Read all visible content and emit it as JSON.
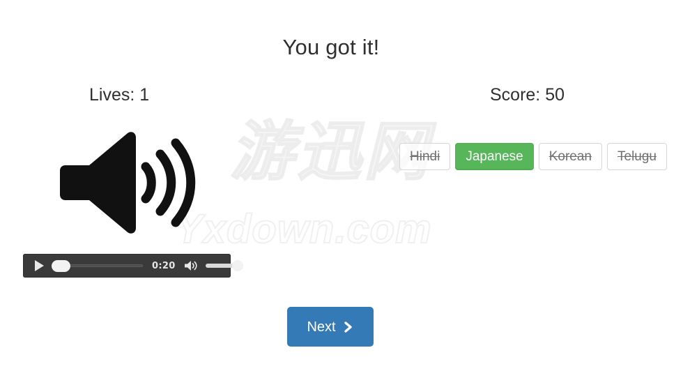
{
  "page": {
    "title": "You got it!",
    "background_color": "#ffffff"
  },
  "status": {
    "lives_label": "Lives: 1",
    "score_label": "Score: 50"
  },
  "prompt": {
    "icon": "speaker-volume-icon"
  },
  "answers": {
    "options": [
      {
        "label": "Hindi",
        "state": "eliminated"
      },
      {
        "label": "Japanese",
        "state": "correct"
      },
      {
        "label": "Korean",
        "state": "eliminated"
      },
      {
        "label": "Telugu",
        "state": "eliminated"
      }
    ],
    "correct_color": "#57b65a",
    "eliminated_text_color": "#707070"
  },
  "audio": {
    "play_icon": "play-icon",
    "time": "0:20",
    "mute_icon": "speaker-icon",
    "progress_percent": 0,
    "volume_percent": 100,
    "background_color": "#3a3a3a"
  },
  "footer": {
    "next_label": "Next",
    "next_icon": "chevron-right-icon",
    "next_color": "#337ab7"
  },
  "watermark": {
    "chinese": "游迅网",
    "english": "Yxdown.com"
  }
}
